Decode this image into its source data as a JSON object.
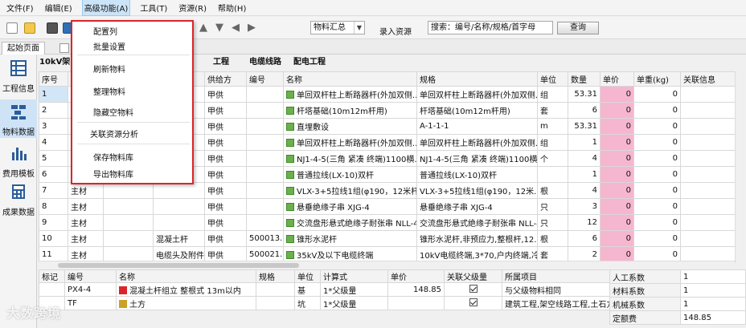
{
  "menubar": {
    "items": [
      "文件(F)",
      "编辑(E)",
      "高级功能(A)",
      "工具(T)",
      "资源(R)",
      "帮助(H)"
    ],
    "active_index": 2
  },
  "toolbar": {
    "combo_value": "物料汇总",
    "record_label": "录入资源",
    "search_placeholder": "搜索：编号/名称/规格/首字母",
    "query_label": "查询"
  },
  "tabs": {
    "start": "起始页面"
  },
  "project": {
    "name": "10kV架",
    "items": [
      "工程",
      "电缆线路",
      "配电工程"
    ]
  },
  "sidebar": [
    {
      "label": "工程信息",
      "icon": "table-icon"
    },
    {
      "label": "物料数据",
      "icon": "bricks-icon"
    },
    {
      "label": "费用模板",
      "icon": "bar-chart-icon"
    },
    {
      "label": "成果数据",
      "icon": "calculator-icon"
    }
  ],
  "grid": {
    "headers": [
      "序号",
      "",
      "",
      "",
      "供给方",
      "编号",
      "名称",
      "规格",
      "单位",
      "数量",
      "单价",
      "单重(kg)",
      "关联信息"
    ],
    "rows": [
      [
        "1",
        "",
        "",
        "",
        "甲供",
        "",
        "单回双杆柱上断路器杆(外加双侧...",
        "单回双杆柱上断路器杆(外加双侧...",
        "组",
        "53.31",
        "0",
        "0",
        ""
      ],
      [
        "2",
        "",
        "",
        "",
        "甲供",
        "",
        "杆塔基础(10m12m杆用)",
        "杆塔基础(10m12m杆用)",
        "套",
        "6",
        "0",
        "0",
        ""
      ],
      [
        "3",
        "",
        "",
        "",
        "甲供",
        "",
        "直埋敷设",
        "A-1-1-1",
        "m",
        "53.31",
        "0",
        "0",
        ""
      ],
      [
        "4",
        "",
        "",
        "",
        "甲供",
        "",
        "单回双杆柱上断路器杆(外加双侧...",
        "单回双杆柱上断路器杆(外加双侧...",
        "组",
        "1",
        "0",
        "0",
        ""
      ],
      [
        "5",
        "",
        "",
        "",
        "甲供",
        "",
        "NJ1-4-5(三角 紧凑 终端)1100横...",
        "NJ1-4-5(三角 紧凑 终端)1100横...",
        "个",
        "4",
        "0",
        "0",
        ""
      ],
      [
        "6",
        "",
        "",
        "",
        "甲供",
        "",
        "普通拉线(LX-10)双杆",
        "普通拉线(LX-10)双杆",
        "",
        "1",
        "0",
        "0",
        ""
      ],
      [
        "7",
        "主材",
        "",
        "",
        "甲供",
        "",
        "VLX-3+5拉线1组(φ190，12米杆...",
        "VLX-3+5拉线1组(φ190，12米...",
        "根",
        "4",
        "0",
        "0",
        ""
      ],
      [
        "8",
        "主材",
        "",
        "",
        "甲供",
        "",
        "悬垂绝缘子串 XJG-4",
        "悬垂绝缘子串 XJG-4",
        "只",
        "3",
        "0",
        "0",
        ""
      ],
      [
        "9",
        "主材",
        "",
        "",
        "甲供",
        "",
        "交流盘形悬式绝缘子耐张串 NLL-4",
        "交流盘形悬式绝缘子耐张串 NLL-4",
        "只",
        "12",
        "0",
        "0",
        ""
      ],
      [
        "10",
        "主材",
        "",
        "混凝土杆",
        "甲供",
        "500013...",
        "锥形水泥杆",
        "锥形水泥杆,非预应力,整根杆,12...",
        "根",
        "6",
        "0",
        "0",
        ""
      ],
      [
        "11",
        "主材",
        "",
        "电缆头及附件",
        "甲供",
        "500021...",
        "35kV及以下电缆终端",
        "10kV电缆终端,3*70,户内终端,冷...",
        "套",
        "2",
        "0",
        "0",
        ""
      ]
    ]
  },
  "bottom": {
    "headers": [
      "标记",
      "编号",
      "名称",
      "规格",
      "单位",
      "计算式",
      "单价",
      "关联父级量",
      "所属项目"
    ],
    "rows": [
      [
        "",
        "PX4-4",
        "混凝土杆组立 整根式 13m以内",
        "",
        "基",
        "1*父级量",
        "148.85",
        "true",
        "与父级物料相同"
      ],
      [
        "",
        "TF",
        "土方",
        "",
        "坑",
        "1*父级量",
        "",
        "true",
        "建筑工程,架空线路工程,土石方工程"
      ]
    ]
  },
  "coef": [
    [
      "人工系数",
      "1"
    ],
    [
      "材料系数",
      "1"
    ],
    [
      "机械系数",
      "1"
    ],
    [
      "定额费",
      "148.85"
    ]
  ],
  "dropdown": {
    "items": [
      "配置列",
      "批量设置",
      "刷新物料",
      "整理物料",
      "隐藏空物料",
      "关联资源分析",
      "保存物料库",
      "导出物料库"
    ]
  },
  "watermark": "大数跨境",
  "colors": {
    "accent_red": "#d9262b",
    "pink_cell": "#f7b6cf",
    "selected": "#d2e6f8"
  }
}
